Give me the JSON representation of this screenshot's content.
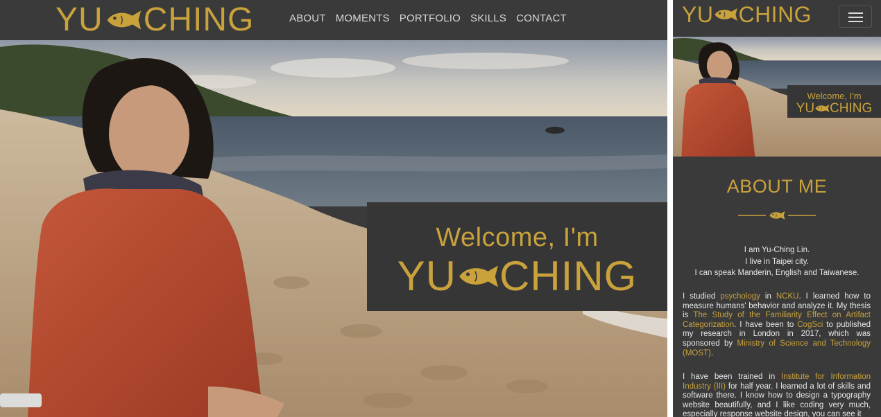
{
  "desktop": {
    "brand": {
      "left": "YU",
      "right": "CHING"
    },
    "nav": [
      "ABOUT",
      "MOMENTS",
      "PORTFOLIO",
      "SKILLS",
      "CONTACT"
    ],
    "hero": {
      "welcome": "Welcome, I'm",
      "name_left": "YU",
      "name_right": "CHING"
    }
  },
  "mobile": {
    "brand": {
      "left": "YU",
      "right": "CHING"
    },
    "hero": {
      "welcome": "Welcome, I'm",
      "name_left": "YU",
      "name_right": "CHING"
    },
    "about": {
      "title": "ABOUT ME",
      "intro": [
        "I am Yu-Ching Lin.",
        "I live in Taipei city.",
        "I can speak Manderin, English and Taiwanese."
      ],
      "p1": {
        "t1": "I studied ",
        "l1": "psychology",
        "t2": " in ",
        "l2": "NCKU",
        "t3": ". I learned how to measure humans' behavior and analyze it. My thesis is ",
        "l3": "The Study of the Familiarity Effect on Artifact Categorization",
        "t4": ". I have been to ",
        "l4": "CogSci",
        "t5": " to published my research in London in 2017, which was sponsored by ",
        "l5": "Ministry of Science and Technology (MOST)",
        "t6": "."
      },
      "p2": {
        "t1": "I have been trained in ",
        "l1": "Institute for Information Industry (III)",
        "t2": " for half year. I learned a lot of skills and software there. I know how to design a typography website beautifully, and I like coding very much, especially response website design, you can see it"
      }
    }
  },
  "colors": {
    "gold": "#c9a23c",
    "dark": "#3a3a3a",
    "box": "#363636",
    "text": "#e8e8e8"
  }
}
